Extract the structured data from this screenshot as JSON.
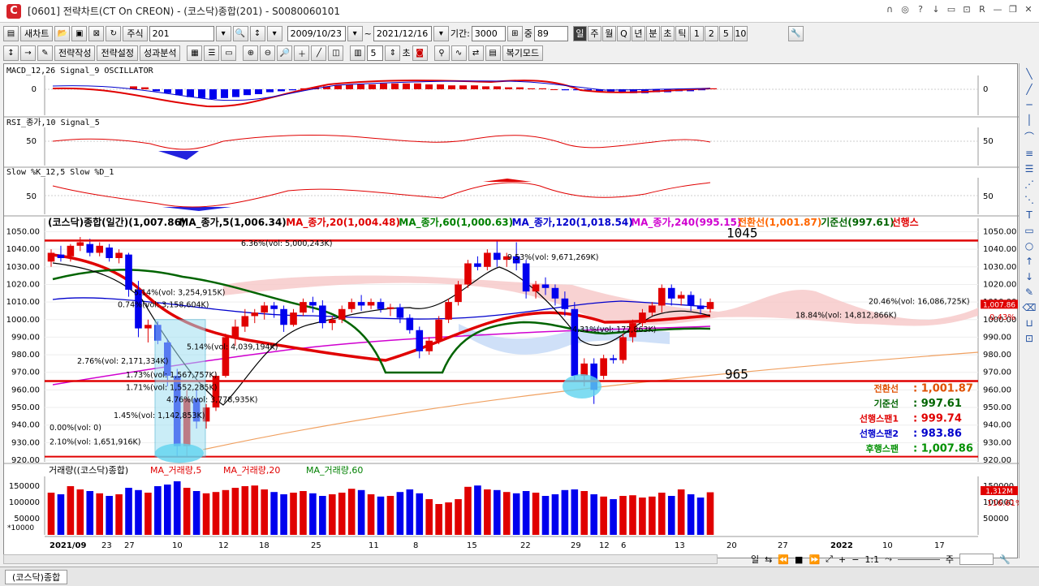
{
  "window": {
    "logo": "C",
    "title": "[0601] 전략차트(CT On CREON) - (코스닥)종합(201) - S0080060101",
    "controls": [
      "∩",
      "◎",
      "?",
      "↓",
      "▭",
      "⊡",
      "R",
      "—",
      "❐",
      "✕"
    ]
  },
  "toolbar1": {
    "new_chart": "새차트",
    "stock_type": "주식",
    "code": "201",
    "date_from": "2009/10/23",
    "date_sep": "~",
    "date_to": "2021/12/16",
    "period_label": "기간:",
    "period_value": "3000",
    "count_label": "중",
    "count_value": "89",
    "timeframes": [
      "일",
      "주",
      "월",
      "Q",
      "년",
      "분",
      "초",
      "틱",
      "1",
      "2",
      "5",
      "10"
    ],
    "active_tf": "일"
  },
  "toolbar2": {
    "strategy_write": "전략작성",
    "strategy_settings": "전략설정",
    "performance": "성과분석",
    "num_value": "5",
    "unit": "초",
    "replay": "복기모드"
  },
  "panels": {
    "macd": {
      "title": "MACD_12,26  Signal_9  OSCILLATOR",
      "zero": "0"
    },
    "rsi": {
      "title": "RSI_종가,10  Signal_5",
      "level": "50"
    },
    "slow": {
      "title": "Slow %K_12,5  Slow %D_1",
      "level": "50"
    }
  },
  "legend": [
    {
      "text": "(코스닥)종합(일간)(1,007.86)",
      "color": "#000000"
    },
    {
      "text": "MA_종가,5(1,006.34)",
      "color": "#000000"
    },
    {
      "text": "MA_종가,20(1,004.48)",
      "color": "#e00000"
    },
    {
      "text": "MA_종가,60(1,000.63)",
      "color": "#008000"
    },
    {
      "text": "MA_종가,120(1,018.54)",
      "color": "#0000cc"
    },
    {
      "text": "MA_종가,240(995.15)",
      "color": "#d000d0"
    },
    {
      "text": "전환선(1,001.87)",
      "color": "#ff6600"
    },
    {
      "text": "기준선(997.61)",
      "color": "#006400"
    },
    {
      "text": "선행스",
      "color": "#e00000"
    }
  ],
  "price_axis": [
    "1050.00",
    "1040.00",
    "1030.00",
    "1020.00",
    "1010.00",
    "1000.00",
    "990.00",
    "980.00",
    "970.00",
    "960.00",
    "950.00",
    "940.00",
    "930.00",
    "920.00"
  ],
  "annotations": {
    "level_high": "1045",
    "level_low": "965",
    "range_labels": [
      "6.36%(vol: 5,000,243K)",
      "9.53%(vol: 9,671,269K)",
      "5.14%(vol: 3,254,915K)",
      "0.74%(vol: 3,158,604K)",
      "5.14%(vol: 4,039,194K)",
      "2.76%(vol: 2,171,334K)",
      "1.73%(vol: 1,567,757K)",
      "1.71%(vol: 1,552,285K)",
      "4.76%(vol: 3,778,935K)",
      "1.45%(vol: 1,142,853K)",
      "0.00%(vol: 0)",
      "2.10%(vol: 1,651,916K)",
      "20.46%(vol: 16,086,725K)",
      "18.84%(vol: 14,812,866K)",
      "4.31%(vol: 172,863K)"
    ],
    "last_price": "1,007.86",
    "last_change": "0.43%"
  },
  "ichimoku_box": [
    {
      "label": "전환선",
      "value": ": 1,001.87",
      "color": "#e05000"
    },
    {
      "label": "기준선",
      "value": ":    997.61",
      "color": "#006400"
    },
    {
      "label": "선행스팬1",
      "value": ":    999.74",
      "color": "#e00000"
    },
    {
      "label": "선행스팬2",
      "value": ":    983.86",
      "color": "#0000cc"
    },
    {
      "label": "후행스팬",
      "value": ": 1,007.86",
      "color": "#009000"
    }
  ],
  "volume": {
    "title": "거래량((코스닥)종합)",
    "ma5": "MA_거래량,5",
    "ma20": "MA_거래량,20",
    "ma60": "MA_거래량,60",
    "unit": "*10000",
    "axis": [
      "150000",
      "100000",
      "50000"
    ],
    "last": "1,312M",
    "pct": "116.61%"
  },
  "xaxis": {
    "labels": [
      "2021/09",
      "23",
      "27",
      "10",
      "12",
      "18",
      "25",
      "11",
      "8",
      "15",
      "22",
      "29",
      "12",
      "6",
      "13",
      "20",
      "27",
      "2022",
      "10",
      "17"
    ]
  },
  "chart_data": {
    "type": "candlestick",
    "ohlc": [
      [
        1033,
        1040,
        1030,
        1038
      ],
      [
        1037,
        1042,
        1033,
        1035
      ],
      [
        1036,
        1043,
        1033,
        1042
      ],
      [
        1042,
        1047,
        1039,
        1044
      ],
      [
        1043,
        1046,
        1036,
        1038
      ],
      [
        1038,
        1044,
        1036,
        1042
      ],
      [
        1041,
        1043,
        1033,
        1035
      ],
      [
        1035,
        1040,
        1032,
        1038
      ],
      [
        1037,
        1038,
        1013,
        1017
      ],
      [
        1017,
        1022,
        990,
        995
      ],
      [
        995,
        1000,
        987,
        997
      ],
      [
        997,
        999,
        986,
        988
      ],
      [
        987,
        989,
        962,
        968
      ],
      [
        968,
        972,
        922,
        928
      ],
      [
        928,
        960,
        922,
        955
      ],
      [
        955,
        960,
        938,
        942
      ],
      [
        942,
        952,
        938,
        950
      ],
      [
        950,
        970,
        948,
        968
      ],
      [
        968,
        992,
        967,
        990
      ],
      [
        990,
        1000,
        985,
        996
      ],
      [
        996,
        1006,
        993,
        1002
      ],
      [
        1002,
        1006,
        998,
        1004
      ],
      [
        1004,
        1010,
        1000,
        1008
      ],
      [
        1008,
        1010,
        1001,
        1006
      ],
      [
        1006,
        1008,
        993,
        997
      ],
      [
        997,
        1006,
        996,
        1004
      ],
      [
        1004,
        1012,
        1002,
        1010
      ],
      [
        1010,
        1013,
        1004,
        1008
      ],
      [
        1008,
        1011,
        995,
        998
      ],
      [
        998,
        1002,
        994,
        1000
      ],
      [
        1000,
        1008,
        998,
        1006
      ],
      [
        1006,
        1012,
        1004,
        1010
      ],
      [
        1010,
        1014,
        1005,
        1008
      ],
      [
        1008,
        1012,
        1006,
        1010
      ],
      [
        1010,
        1012,
        1004,
        1006
      ],
      [
        1006,
        1009,
        1002,
        1007
      ],
      [
        1007,
        1009,
        998,
        1001
      ],
      [
        1001,
        1003,
        992,
        994
      ],
      [
        994,
        996,
        978,
        982
      ],
      [
        982,
        990,
        980,
        988
      ],
      [
        988,
        1002,
        986,
        1000
      ],
      [
        1000,
        1012,
        998,
        1010
      ],
      [
        1010,
        1022,
        1008,
        1020
      ],
      [
        1020,
        1034,
        1018,
        1032
      ],
      [
        1032,
        1036,
        1028,
        1030
      ],
      [
        1030,
        1040,
        1028,
        1038
      ],
      [
        1038,
        1045,
        1030,
        1034
      ],
      [
        1034,
        1038,
        1030,
        1036
      ],
      [
        1036,
        1044,
        1028,
        1032
      ],
      [
        1032,
        1034,
        1012,
        1016
      ],
      [
        1016,
        1022,
        1012,
        1020
      ],
      [
        1020,
        1024,
        1014,
        1018
      ],
      [
        1018,
        1020,
        1008,
        1012
      ],
      [
        1012,
        1016,
        1002,
        1006
      ],
      [
        1006,
        1010,
        965,
        968
      ],
      [
        968,
        978,
        962,
        975
      ],
      [
        975,
        978,
        952,
        960
      ],
      [
        968,
        980,
        966,
        978
      ],
      [
        978,
        980,
        975,
        977
      ],
      [
        977,
        992,
        975,
        990
      ],
      [
        990,
        1000,
        987,
        998
      ],
      [
        998,
        1006,
        996,
        1004
      ],
      [
        1004,
        1010,
        1002,
        1008
      ],
      [
        1008,
        1020,
        1004,
        1018
      ],
      [
        1018,
        1020,
        1008,
        1012
      ],
      [
        1012,
        1016,
        1008,
        1014
      ],
      [
        1014,
        1016,
        1005,
        1008
      ],
      [
        1008,
        1012,
        1003,
        1006
      ],
      [
        1006,
        1012,
        1004,
        1010
      ]
    ],
    "volume": [
      130000,
      125000,
      150000,
      140000,
      135000,
      128000,
      120000,
      125000,
      145000,
      138000,
      130000,
      150000,
      155000,
      165000,
      145000,
      135000,
      128000,
      132000,
      138000,
      145000,
      150000,
      152000,
      140000,
      132000,
      125000,
      130000,
      135000,
      128000,
      120000,
      125000,
      130000,
      142000,
      138000,
      125000,
      118000,
      120000,
      132000,
      140000,
      128000,
      110000,
      95000,
      100000,
      110000,
      148000,
      152000,
      140000,
      138000,
      132000,
      128000,
      135000,
      130000,
      120000,
      125000,
      138000,
      140000,
      135000,
      125000,
      118000,
      110000,
      120000,
      122000,
      115000,
      118000,
      130000,
      120000,
      140000,
      125000,
      115000,
      131200
    ],
    "price_range": [
      920,
      1053
    ],
    "levels": [
      1045,
      965
    ]
  }
}
